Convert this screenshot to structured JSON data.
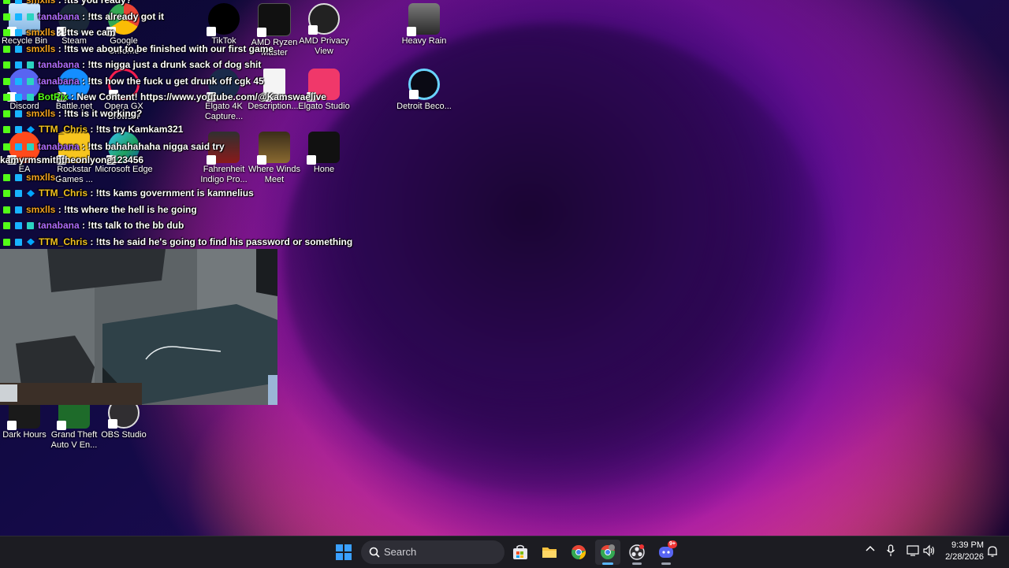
{
  "desktop_icons": [
    {
      "label": "Recycle Bin",
      "icon": "recycle-bin-icon"
    },
    {
      "label": "Steam",
      "icon": "steam-icon"
    },
    {
      "label": "Google Chrome",
      "icon": "chrome-icon"
    },
    {
      "label": "TikTok",
      "icon": "tiktok-icon"
    },
    {
      "label": "AMD Ryzen Master",
      "icon": "amd-ryzen-icon"
    },
    {
      "label": "AMD Privacy View",
      "icon": "amd-privacy-icon"
    },
    {
      "label": "Heavy Rain",
      "icon": "heavy-rain-icon"
    },
    {
      "label": "Discord",
      "icon": "discord-icon"
    },
    {
      "label": "Battle.net",
      "icon": "battlenet-icon"
    },
    {
      "label": "Opera GX Browser",
      "icon": "opera-gx-icon"
    },
    {
      "label": "Elgato 4K Capture...",
      "icon": "elgato-4k-icon"
    },
    {
      "label": "Description....",
      "icon": "document-icon"
    },
    {
      "label": "Elgato Studio",
      "icon": "elgato-studio-icon"
    },
    {
      "label": "Detroit Beco...",
      "icon": "detroit-icon"
    },
    {
      "label": "EA",
      "icon": "ea-icon"
    },
    {
      "label": "Rockstar Games ...",
      "icon": "rockstar-icon"
    },
    {
      "label": "Microsoft Edge",
      "icon": "edge-icon"
    },
    {
      "label": "Fahrenheit Indigo Pro...",
      "icon": "fahrenheit-icon"
    },
    {
      "label": "Where Winds Meet",
      "icon": "where-winds-icon"
    },
    {
      "label": "Hone",
      "icon": "hone-icon"
    },
    {
      "label": "Dark Hours",
      "icon": "dark-hours-icon"
    },
    {
      "label": "Grand Theft Auto V En...",
      "icon": "gta-icon"
    },
    {
      "label": "OBS Studio",
      "icon": "obs-icon"
    }
  ],
  "chat": [
    {
      "user": "smxlls",
      "text": " : !tts you ready?",
      "color": "#f0a020",
      "badges": [
        "bk",
        "bs"
      ]
    },
    {
      "user": "tanabana",
      "text": " : !tts already got it",
      "color": "#b06cff",
      "badges": [
        "bk",
        "bs",
        "bg"
      ]
    },
    {
      "user": "smxlls",
      "text": " : !tts we cam",
      "color": "#f0a020",
      "badges": [
        "bk",
        "bs"
      ]
    },
    {
      "user": "smxlls",
      "text": " : !tts we about to be finished with our first game",
      "color": "#f0a020",
      "badges": [
        "bk",
        "bs"
      ]
    },
    {
      "user": "tanabana",
      "text": " : !tts nigga just a drunk sack of dog shit",
      "color": "#b06cff",
      "badges": [
        "bk",
        "bs",
        "bg"
      ]
    },
    {
      "user": "tanabana",
      "text": " : !tts how the fuck u get drunk off cgk 45",
      "color": "#b06cff",
      "badges": [
        "bk",
        "bs",
        "bg"
      ]
    },
    {
      "user": "BotRix",
      "text": " : New Content! https://www.youtube.com/@Kamswaelive",
      "color": "#53fc18",
      "badges": [
        "bk",
        "bs",
        "bg"
      ]
    },
    {
      "user": "smxlls",
      "text": " : !tts is it working?",
      "color": "#f0a020",
      "badges": [
        "bk",
        "bs"
      ]
    },
    {
      "user": "TTM_Chris",
      "text": " : !tts try Kamkam321",
      "color": "#f0c020",
      "badges": [
        "bk",
        "bs",
        "bc"
      ]
    },
    {
      "user": "tanabana",
      "text": " : !tts bahahahaha nigga said try kamyrmsmiththeonlyone123456",
      "color": "#b06cff",
      "badges": [
        "bk",
        "bs",
        "bg"
      ],
      "wrap": true
    },
    {
      "user": "smxlls",
      "text": " : ",
      "color": "#f0a020",
      "badges": [
        "bk",
        "bs"
      ]
    },
    {
      "user": "TTM_Chris",
      "text": " : !tts kams government is kamnelius",
      "color": "#f0c020",
      "badges": [
        "bk",
        "bs",
        "bc"
      ]
    },
    {
      "user": "smxlls",
      "text": " : !tts where the hell is he going",
      "color": "#f0a020",
      "badges": [
        "bk",
        "bs"
      ]
    },
    {
      "user": "tanabana",
      "text": " : !tts talk to the bb dub",
      "color": "#b06cff",
      "badges": [
        "bk",
        "bs",
        "bg"
      ]
    },
    {
      "user": "TTM_Chris",
      "text": " : !tts he said he's going to find his password or something",
      "color": "#f0c020",
      "badges": [
        "bk",
        "bs",
        "bc"
      ]
    }
  ],
  "taskbar": {
    "search_label": "Search",
    "apps": [
      {
        "name": "start",
        "icon": "windows-start-icon"
      },
      {
        "name": "store",
        "icon": "microsoft-store-icon"
      },
      {
        "name": "explorer",
        "icon": "file-explorer-icon"
      },
      {
        "name": "chrome",
        "icon": "chrome-icon"
      },
      {
        "name": "chrome-profile",
        "icon": "chrome-profile-icon"
      },
      {
        "name": "obs",
        "icon": "obs-icon"
      },
      {
        "name": "discord",
        "icon": "discord-icon",
        "badge": "9+"
      }
    ],
    "time": "9:39 PM",
    "date": "2/28/2026"
  },
  "colors": {
    "taskbar_bg": "#1c1c22",
    "accent": "#5ab6ff"
  }
}
